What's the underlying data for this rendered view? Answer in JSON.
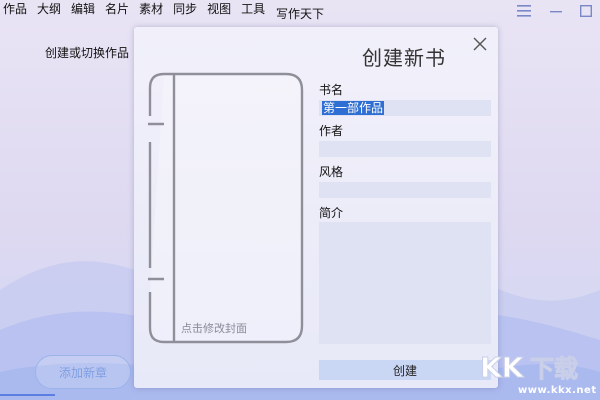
{
  "menu": {
    "items": [
      {
        "label": "作品"
      },
      {
        "label": "大纲"
      },
      {
        "label": "编辑"
      },
      {
        "label": "名片"
      },
      {
        "label": "素材"
      },
      {
        "label": "同步"
      },
      {
        "label": "视图"
      },
      {
        "label": "工具"
      }
    ]
  },
  "app": {
    "title": "写作天下"
  },
  "sidebar": {
    "switch_works": "创建或切换作品",
    "add_chapter": "添加新章"
  },
  "dialog": {
    "title": "创建新书",
    "cover_caption": "点击修改封面",
    "fields": {
      "title_label": "书名",
      "title_value": "第一部作品",
      "author_label": "作者",
      "author_value": "",
      "style_label": "风格",
      "style_value": "",
      "intro_label": "简介",
      "intro_value": ""
    },
    "create_button": "创建"
  },
  "watermark": {
    "logo_text": "KK下载",
    "url": "www.kkx.net"
  },
  "colors": {
    "accent": "#2f6fd3",
    "button_outline": "#9ab4ea",
    "create_button_bg": "#c9d6f4",
    "input_bg": "#dfe2f3"
  }
}
